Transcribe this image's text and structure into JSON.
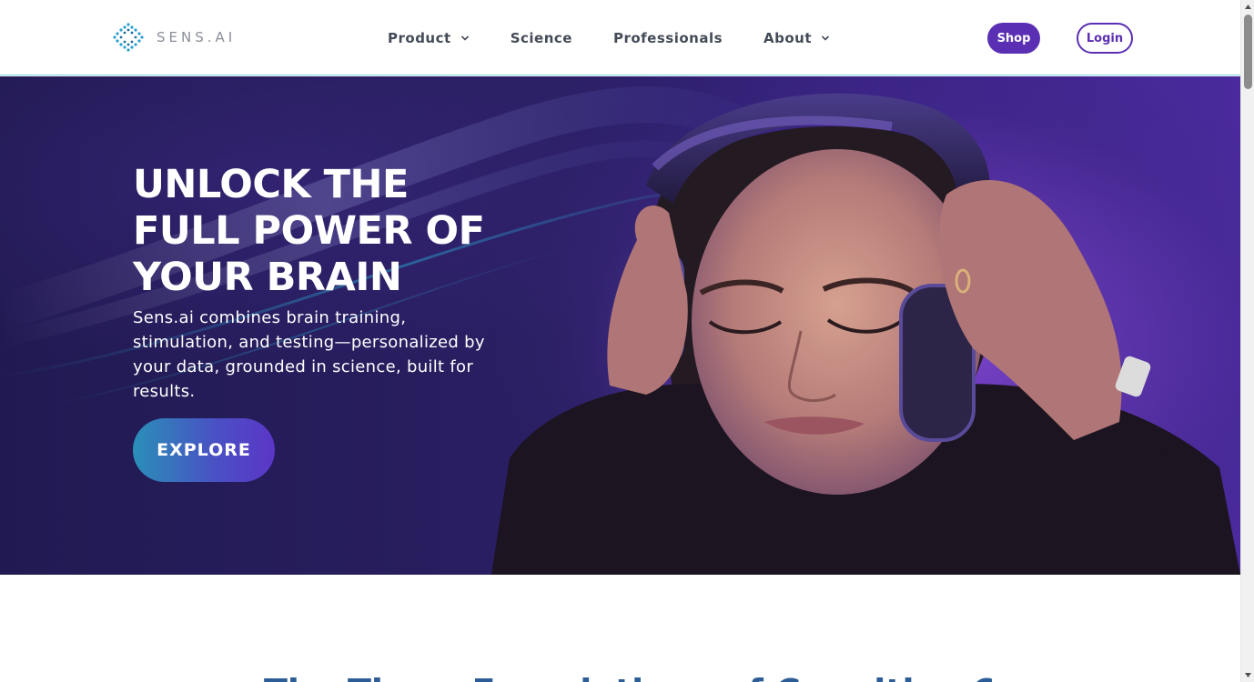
{
  "brand": {
    "name": "SENS.AI",
    "accent_color": "#5b2fb3",
    "logo_color": "#2a9fcf"
  },
  "nav": {
    "items": [
      {
        "label": "Product",
        "has_dropdown": true
      },
      {
        "label": "Science",
        "has_dropdown": false
      },
      {
        "label": "Professionals",
        "has_dropdown": false
      },
      {
        "label": "About",
        "has_dropdown": true
      }
    ],
    "shop_label": "Shop",
    "login_label": "Login"
  },
  "hero": {
    "title_line1": "UNLOCK THE",
    "title_line2": "FULL POWER OF",
    "title_line3": "YOUR BRAIN",
    "subtitle": "Sens.ai combines brain training, stimulation, and testing—personalized by your data, grounded in science, built for results.",
    "cta_label": "EXPLORE"
  },
  "next_section": {
    "heading": "The Three Foundations of Cognitive Optimization"
  }
}
